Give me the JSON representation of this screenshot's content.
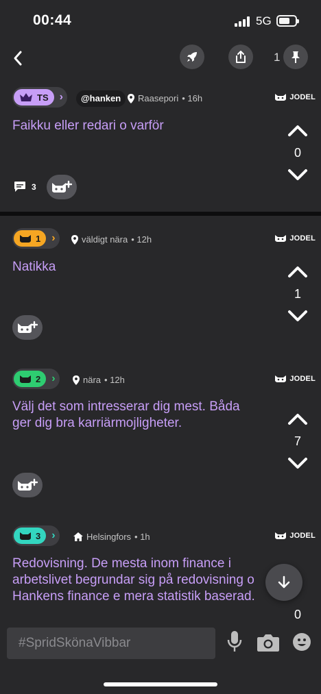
{
  "status": {
    "time": "00:44",
    "network": "5G"
  },
  "topbar": {
    "pin_count": "1"
  },
  "posts": [
    {
      "badge": "TS",
      "handle": "@hanken",
      "location": "Raasepori",
      "time": "• 16h",
      "brand": "JODEL",
      "text": "Faikku eller redari o varför",
      "votes": "0",
      "comments": "3",
      "badge_color": "#c79ef7"
    },
    {
      "badge": "1",
      "location": "väldigt nära",
      "time": "• 12h",
      "brand": "JODEL",
      "text": "Natikka",
      "votes": "1",
      "badge_color": "#f5a623"
    },
    {
      "badge": "2",
      "location": "nära",
      "time": "• 12h",
      "brand": "JODEL",
      "text": "Välj det som intresserar dig mest. Båda ger dig bra karriärmojligheter.",
      "votes": "7",
      "badge_color": "#2ecc71"
    },
    {
      "badge": "3",
      "location": "Helsingfors",
      "time": "• 1h",
      "brand": "JODEL",
      "text": "Redovisning. De mesta inom finance i arbetslivet begrundar sig på redovisning o Hankens finance e mera statistik baserad.",
      "votes": "0",
      "badge_color": "#33d6c0"
    }
  ],
  "composer": {
    "placeholder": "#SpridSkönaVibbar"
  },
  "colors": {
    "accent_text": "#c79ef7",
    "background": "#28282a"
  }
}
